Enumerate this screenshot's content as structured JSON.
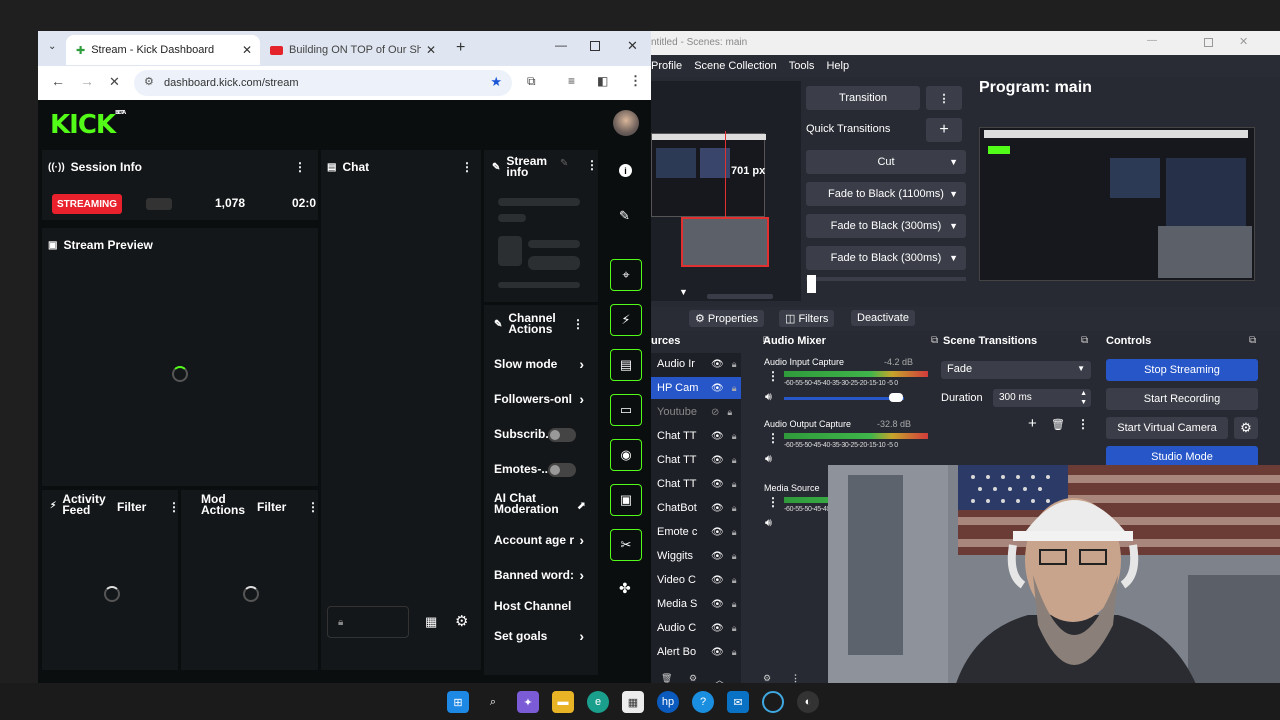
{
  "browser": {
    "tabs": [
      {
        "label": "Stream - Kick Dashboard",
        "active": true
      },
      {
        "label": "Building ON TOP of Our Shipp",
        "active": false
      }
    ],
    "url": "dashboard.kick.com/stream"
  },
  "kick": {
    "logo": "KICK",
    "logo_badge": "BETA",
    "session_info": {
      "title": "Session Info",
      "status": "STREAMING",
      "viewers": "1,078",
      "time": "02:0"
    },
    "chat": {
      "title": "Chat"
    },
    "stream_info": {
      "title": "Stream info"
    },
    "stream_preview": {
      "title": "Stream Preview"
    },
    "activity_feed": {
      "title": "Activity Feed",
      "filter": "Filter"
    },
    "mod_actions": {
      "title": "Mod Actions",
      "filter": "Filter"
    },
    "channel_actions": {
      "title": "Channel Actions",
      "items": [
        "Slow mode",
        "Followers-onl",
        "Subscrib...",
        "Emotes-...",
        "AI Chat Moderation",
        "Account age r",
        "Banned word:",
        "Host Channel",
        "Set goals"
      ]
    }
  },
  "obs": {
    "window_title": "ntitled - Scenes: main",
    "menu": [
      "Profile",
      "Scene Collection",
      "Tools",
      "Help"
    ],
    "transition_label": "Transition",
    "quick_transitions": "Quick Transitions",
    "transitions": [
      "Cut",
      "Fade to Black (1100ms)",
      "Fade to Black (300ms)",
      "Fade to Black (300ms)"
    ],
    "program_title": "Program: main",
    "preview_size_label": "701 px",
    "toolbar": {
      "properties": "Properties",
      "filters": "Filters",
      "deactivate": "Deactivate"
    },
    "docks": {
      "sources": "urces",
      "audio_mixer": "Audio Mixer",
      "scene_transitions": "Scene Transitions",
      "controls": "Controls"
    },
    "sources": [
      "Audio Ir",
      "HP Cam",
      "Youtube",
      "Chat TT",
      "Chat TT",
      "Chat TT",
      "ChatBot",
      "Emote c",
      "Wiggits",
      "Video C",
      "Media S",
      "Audio C",
      "Alert Bo"
    ],
    "mixer": [
      {
        "name": "Audio Input Capture",
        "db": "-4.2 dB"
      },
      {
        "name": "Audio Output Capture",
        "db": "-32.8 dB"
      },
      {
        "name": "Media Source",
        "db": ""
      }
    ],
    "meter_scale": "-60-55-50-45-40-35-30-25-20-15-10 -5  0",
    "scene_transition": {
      "value": "Fade",
      "duration_label": "Duration",
      "duration": "300 ms"
    },
    "controls": [
      "Stop Streaming",
      "Start Recording",
      "Start Virtual Camera",
      "Studio Mode"
    ]
  }
}
